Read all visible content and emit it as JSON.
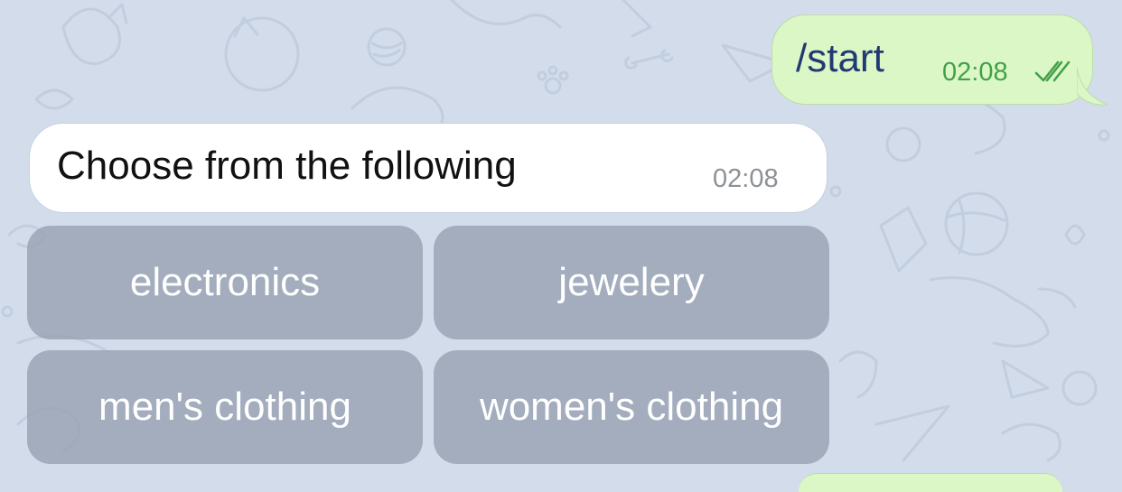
{
  "chat": {
    "outgoing": {
      "text": "/start",
      "time": "02:08",
      "status_icon": "double-check-icon"
    },
    "incoming": {
      "text": "Choose from the following",
      "time": "02:08"
    },
    "keyboard": {
      "buttons": [
        {
          "label": "electronics"
        },
        {
          "label": "jewelery"
        },
        {
          "label": "men's clothing"
        },
        {
          "label": "women's clothing"
        }
      ]
    }
  },
  "colors": {
    "background": "#d3dcea",
    "outgoing_bubble": "#dbf7c5",
    "incoming_bubble": "#ffffff",
    "outgoing_text": "#223a72",
    "outgoing_time": "#43a04a",
    "incoming_time": "#8d9196",
    "keyboard_button": "#96a0b0"
  }
}
